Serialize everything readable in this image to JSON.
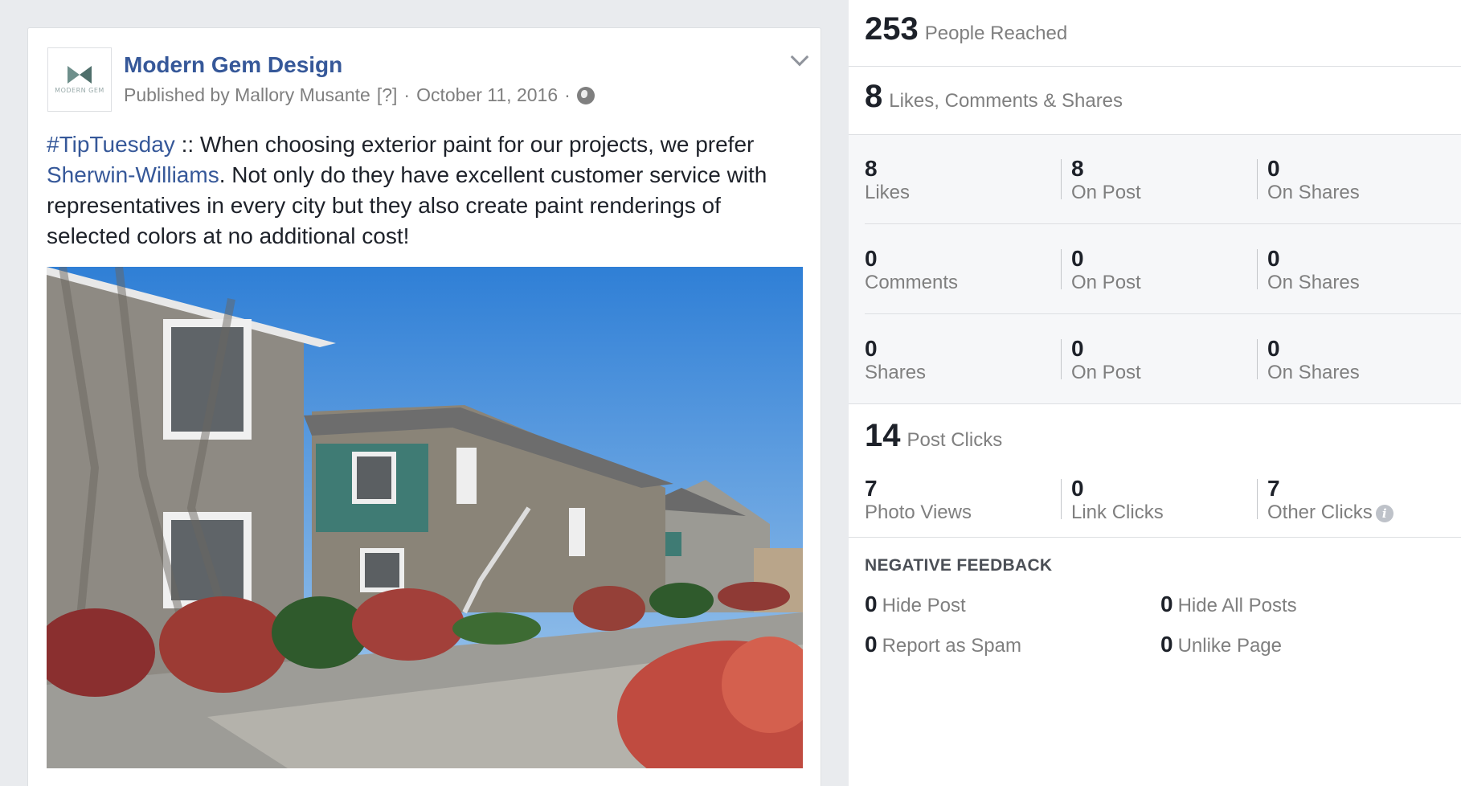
{
  "post": {
    "page_name": "Modern Gem Design",
    "avatar_logo_text": "MODERN GEM",
    "published_by": "Published by Mallory Musante",
    "help_marker": "[?]",
    "date": "October 11, 2016",
    "hashtag": "#TipTuesday",
    "text_part1": " :: When choosing exterior paint for our projects, we prefer ",
    "mention": "Sherwin-Williams",
    "text_part2": ". Not only do they have excellent customer service with representatives in every city but they also create paint renderings of selected colors at no additional cost!",
    "icons": [
      "globe-icon",
      "chevron-down-icon"
    ]
  },
  "insights": {
    "reach": {
      "value": "253",
      "label": "People Reached"
    },
    "engagement": {
      "value": "8",
      "label": "Likes, Comments & Shares"
    },
    "breakdown": [
      {
        "total": {
          "value": "8",
          "label": "Likes"
        },
        "on_post": {
          "value": "8",
          "label": "On Post"
        },
        "on_shares": {
          "value": "0",
          "label": "On Shares"
        }
      },
      {
        "total": {
          "value": "0",
          "label": "Comments"
        },
        "on_post": {
          "value": "0",
          "label": "On Post"
        },
        "on_shares": {
          "value": "0",
          "label": "On Shares"
        }
      },
      {
        "total": {
          "value": "0",
          "label": "Shares"
        },
        "on_post": {
          "value": "0",
          "label": "On Post"
        },
        "on_shares": {
          "value": "0",
          "label": "On Shares"
        }
      }
    ],
    "clicks": {
      "value": "14",
      "label": "Post Clicks",
      "items": [
        {
          "value": "7",
          "label": "Photo Views"
        },
        {
          "value": "0",
          "label": "Link Clicks"
        },
        {
          "value": "7",
          "label": "Other Clicks"
        }
      ]
    },
    "negative": {
      "title": "NEGATIVE FEEDBACK",
      "items": [
        {
          "value": "0",
          "label": "Hide Post"
        },
        {
          "value": "0",
          "label": "Hide All Posts"
        },
        {
          "value": "0",
          "label": "Report as Spam"
        },
        {
          "value": "0",
          "label": "Unlike Page"
        }
      ]
    },
    "info_icon": "i"
  },
  "colors": {
    "link": "#365899",
    "muted": "#7f7f7f",
    "page_bg": "#e9ebee",
    "panel_gray": "#f6f7f9"
  }
}
